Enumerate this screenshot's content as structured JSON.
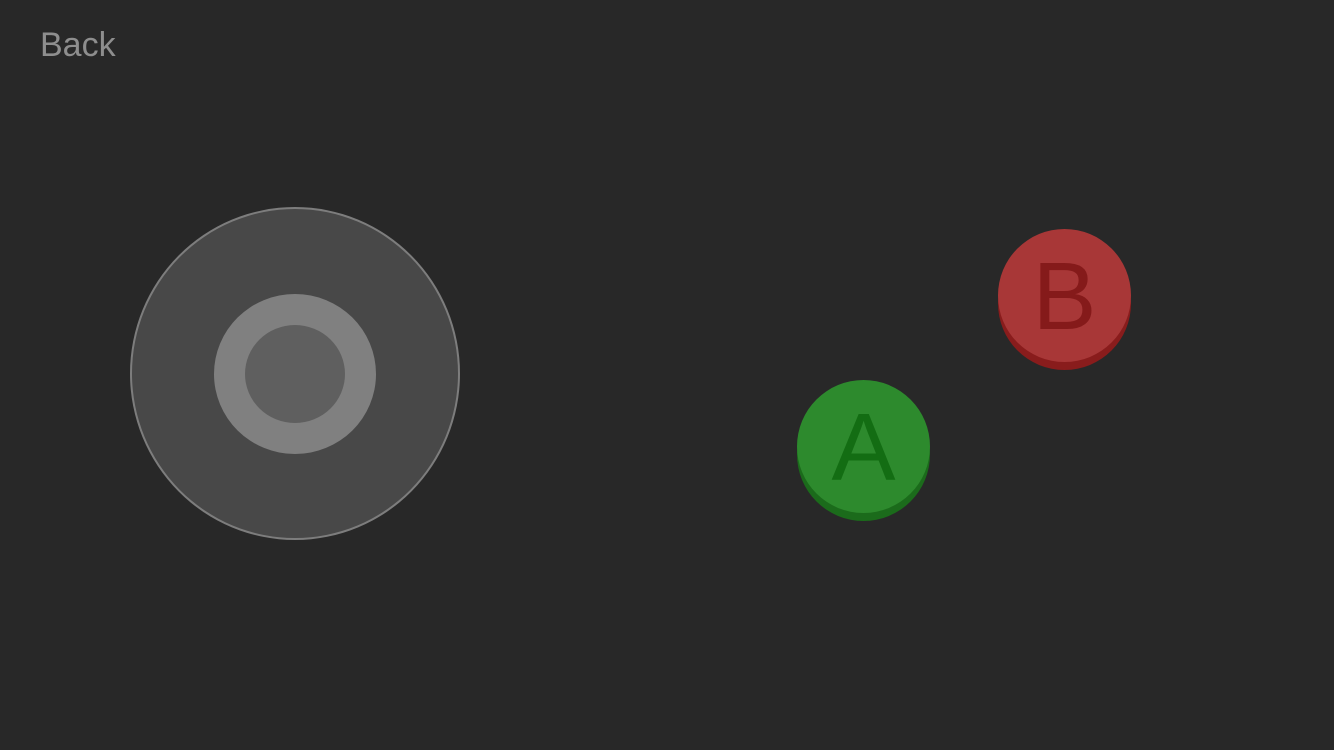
{
  "header": {
    "back_label": "Back"
  },
  "controls": {
    "button_a": {
      "label": "A",
      "color": "#2d8a2d",
      "glyph_color": "#136d13"
    },
    "button_b": {
      "label": "B",
      "color": "#a83737",
      "glyph_color": "#851a1a"
    },
    "joystick": {
      "base_color": "#484848",
      "knob_color": "#808080"
    }
  },
  "colors": {
    "background": "#282828",
    "back_text": "#8e8e8e"
  }
}
